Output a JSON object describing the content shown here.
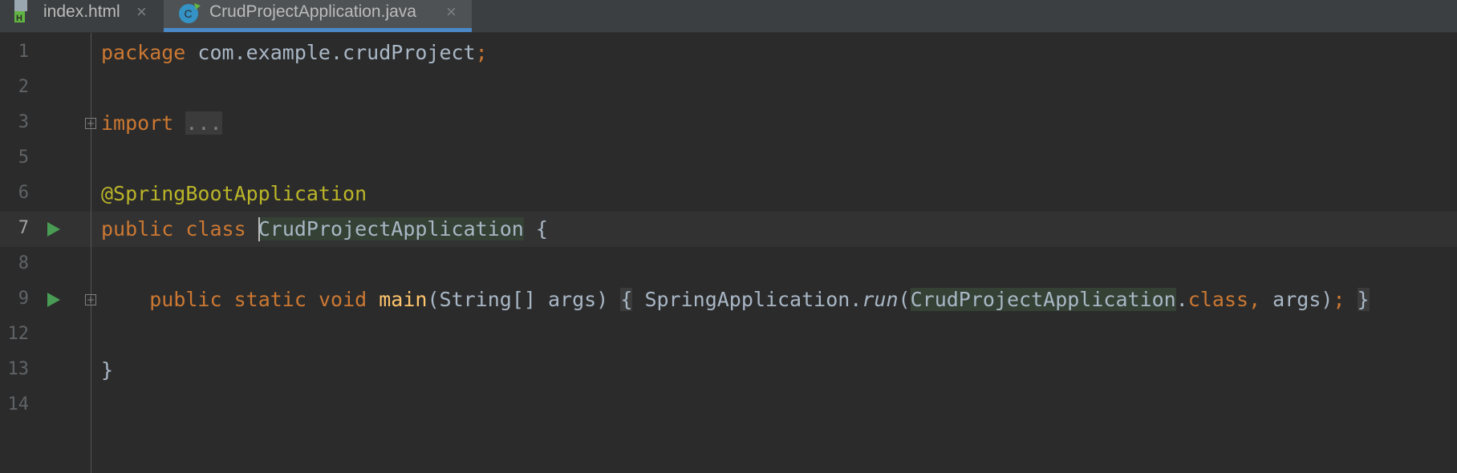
{
  "tabs": [
    {
      "name": "index.html",
      "icon": "html-file-icon",
      "active": false
    },
    {
      "name": "CrudProjectApplication.java",
      "icon": "java-class-icon",
      "active": true
    }
  ],
  "tab_close_glyph": "×",
  "colors": {
    "background": "#2b2b2b",
    "keyword": "#cc7832",
    "annotation": "#bbb529",
    "method": "#ffc66d",
    "text": "#a9b7c6",
    "run_icon": "#499c54",
    "active_tab_underline": "#4a88c7"
  },
  "editor": {
    "lines": [
      {
        "number": "1",
        "tokens": {
          "kw_package": "package",
          "pkg_name": "com.example.crudProject",
          "semicolon": ";"
        }
      },
      {
        "number": "2"
      },
      {
        "number": "3",
        "tokens": {
          "kw_import": "import",
          "fold": "..."
        }
      },
      {
        "number": "5"
      },
      {
        "number": "6",
        "tokens": {
          "annotation": "@SpringBootApplication"
        }
      },
      {
        "number": "7",
        "tokens": {
          "kw_public": "public",
          "kw_class": "class",
          "class_first": "C",
          "class_rest": "rudProjectApplication",
          "brace": "{"
        }
      },
      {
        "number": "8"
      },
      {
        "number": "9",
        "tokens": {
          "kw_public": "public",
          "kw_static": "static",
          "kw_void": "void",
          "method": "main",
          "params": "(String[] args)",
          "open_brace": "{",
          "target": "SpringApplication.",
          "call": "run",
          "lparen": "(",
          "class_ref": "CrudProjectApplication",
          "dot": ".",
          "kw_class": "class",
          "comma": ",",
          "args": " args)",
          "semicolon": ";",
          "close_brace": "}"
        }
      },
      {
        "number": "12"
      },
      {
        "number": "13",
        "tokens": {
          "brace": "}"
        }
      },
      {
        "number": "14"
      }
    ]
  }
}
